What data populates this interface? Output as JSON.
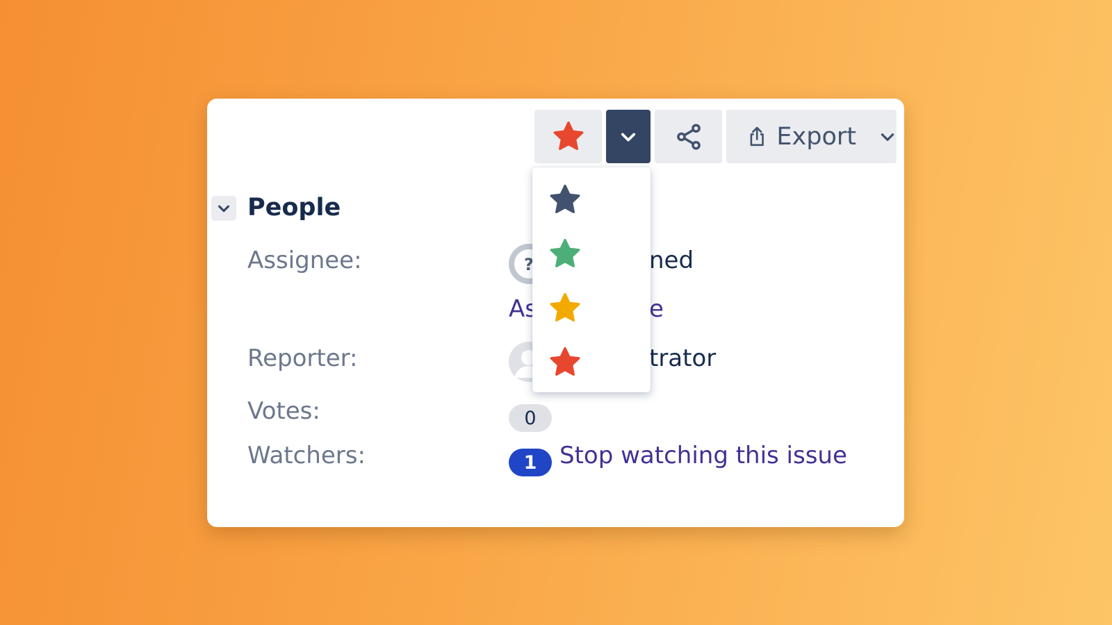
{
  "toolbar": {
    "star_icon": "star-icon",
    "star_color": "#e8472f",
    "dropdown_icon": "chevron-down-icon",
    "share_icon": "share-icon",
    "export_icon": "export-icon",
    "export_label": "Export"
  },
  "star_menu": {
    "items": [
      {
        "icon": "star-icon",
        "color": "#42526e"
      },
      {
        "icon": "star-icon",
        "color": "#4caf78"
      },
      {
        "icon": "star-icon",
        "color": "#f2a900"
      },
      {
        "icon": "star-icon",
        "color": "#e8472f"
      }
    ]
  },
  "people": {
    "title": "People",
    "assignee_label": "Assignee:",
    "assignee_value_visible": "ned",
    "assign_link_visible_left": "As",
    "assign_link_visible_right": "e",
    "reporter_label": "Reporter:",
    "reporter_value_visible": "trator",
    "votes_label": "Votes:",
    "votes_count": "0",
    "watchers_label": "Watchers:",
    "watchers_count": "1",
    "stop_watching_link": "Stop watching this issue"
  },
  "colors": {
    "accent": "#2145c7",
    "link": "#403294",
    "toolbar_dark": "#344563"
  }
}
